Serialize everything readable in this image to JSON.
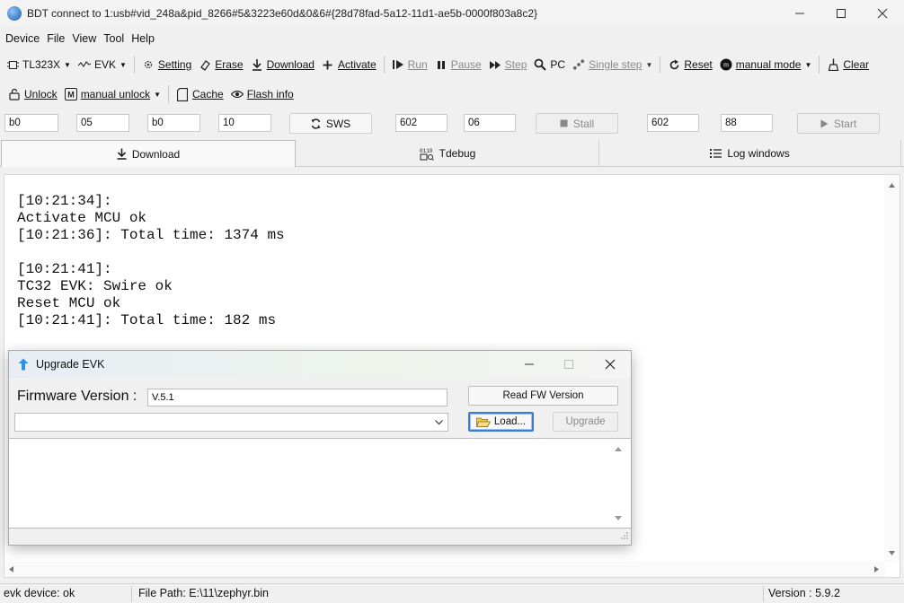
{
  "window": {
    "title": "BDT connect to 1:usb#vid_248a&pid_8266#5&3223e60d&0&6#{28d78fad-5a12-11d1-ae5b-0000f803a8c2}"
  },
  "menu": [
    "Device",
    "File",
    "View",
    "Tool",
    "Help"
  ],
  "toolbar1": {
    "chip": "TL323X",
    "evk": "EVK",
    "setting": "Setting",
    "erase": "Erase",
    "download": "Download",
    "activate": "Activate",
    "run": "Run",
    "pause": "Pause",
    "step": "Step",
    "pc": "PC",
    "single_step": "Single step",
    "reset": "Reset",
    "mode": "manual mode",
    "clear": "Clear"
  },
  "toolbar2": {
    "unlock": "Unlock",
    "manual_unlock": "manual unlock",
    "cache": "Cache",
    "flash_info": "Flash info"
  },
  "params": {
    "p1": "b0",
    "p2": "05",
    "p3": "b0",
    "p4": "10",
    "sws": "SWS",
    "p5": "602",
    "p6": "06",
    "stall": "Stall",
    "p7": "602",
    "p8": "88",
    "start": "Start"
  },
  "tabs": {
    "download": "Download",
    "tdebug": "Tdebug",
    "log": "Log windows"
  },
  "log_text": "[10:21:34]:\nActivate MCU ok\n[10:21:36]: Total time: 1374 ms\n\n[10:21:41]:\nTC32 EVK: Swire ok\nReset MCU ok\n[10:21:41]: Total time: 182 ms",
  "dialog": {
    "title": "Upgrade EVK",
    "fw_label": "Firmware Version :",
    "fw_value": "V.5.1",
    "read_fw": "Read FW Version",
    "load": "Load...",
    "upgrade": "Upgrade"
  },
  "status": {
    "device": "evk device: ok",
    "file_path": "File Path:  E:\\11\\zephyr.bin",
    "version": "Version : 5.9.2"
  },
  "colors": {
    "accent": "#3a7bd5",
    "disabled_text": "#8a8a8a"
  }
}
